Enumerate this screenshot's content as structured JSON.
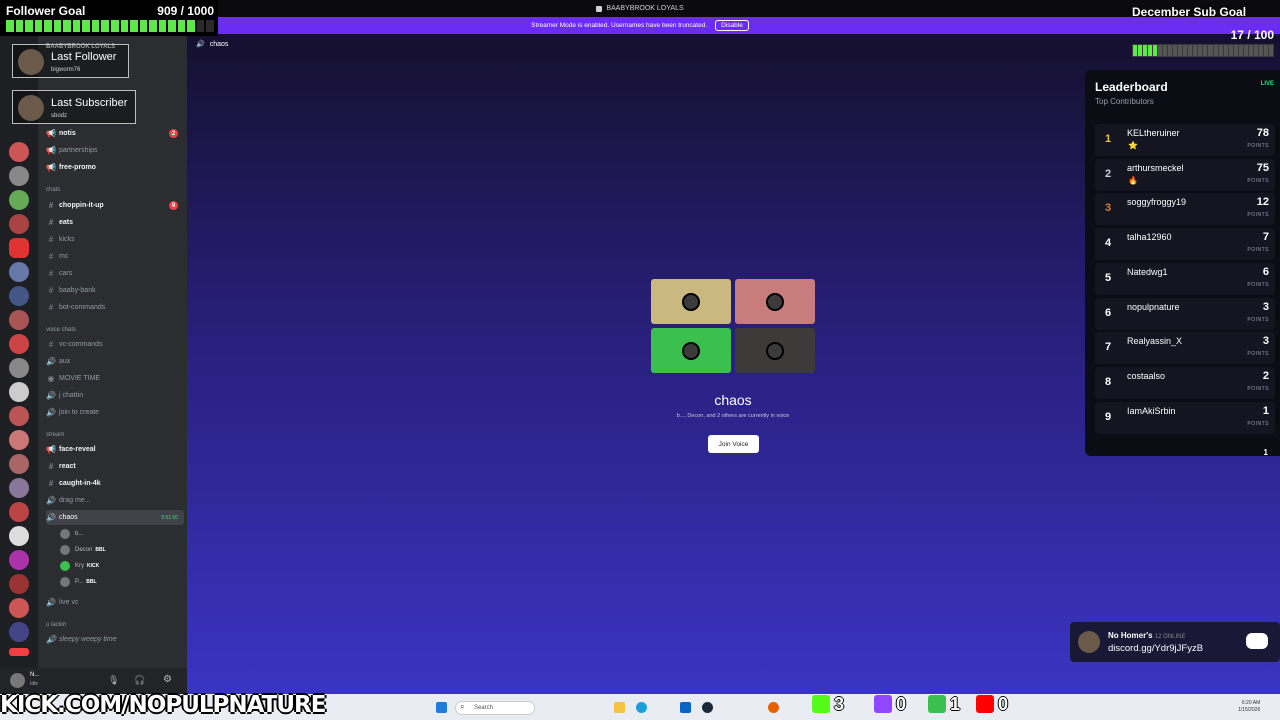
{
  "window": {
    "title": "BAABYBROOK LOYALS"
  },
  "notice": {
    "text": "Streamer Mode is enabled. Usernames have been truncated.",
    "disable_label": "Disable"
  },
  "follower_goal": {
    "title": "Follower Goal",
    "count": "909 / 1000",
    "progress": 0.909
  },
  "sub_goal": {
    "title": "December Sub Goal",
    "count": "17 / 100",
    "progress": 0.17
  },
  "overlays": {
    "last_follower": {
      "label": "Last Follower",
      "name": "bigworm76"
    },
    "last_subscriber": {
      "label": "Last Subscriber",
      "name": "sbodz"
    }
  },
  "server": {
    "name": "BAABYBROOK LOYALS"
  },
  "channels": {
    "c1": "notis",
    "c1_badge": "2",
    "c2": "partnerships",
    "c3": "free-promo",
    "cat_chats": "chats",
    "c4": "choppin-it-up",
    "c4_badge": "9",
    "c5": "eats",
    "c6": "kicks",
    "c7": "mc",
    "c8": "cars",
    "c9": "baaby-bank",
    "c10": "bot-commands",
    "cat_voice": "voice chats",
    "c11": "vc-commands",
    "c12": "aux",
    "c13": "MOVIE TIME",
    "c14": "j chattin",
    "c15": "join to create",
    "cat_stream": "stream",
    "c16": "face-reveal",
    "c17": "react",
    "c18": "caught-in-4k",
    "c19": "drag me...",
    "c20": "chaos",
    "c20_time": "5:51:50",
    "c21": "live vc",
    "cat_lackin": "u lackin",
    "c22": "sleepy weepy time"
  },
  "voice_users": [
    {
      "name": "b...",
      "tag": ""
    },
    {
      "name": "Decon",
      "tag": "BBL"
    },
    {
      "name": "Kry",
      "tag": "KICK"
    },
    {
      "name": "P...",
      "tag": "BBL"
    }
  ],
  "user": {
    "name": "N...",
    "status": "Idle"
  },
  "main": {
    "channel": "chaos",
    "voice_desc": "b..., Decon, and 2 others are currently in voice",
    "join_label": "Join Voice",
    "tile_colors": [
      "#c9b980",
      "#c87c7c",
      "#3bbf4e",
      "#3d3a3a"
    ]
  },
  "leaderboard": {
    "title": "Leaderboard",
    "subtitle": "Top Contributors",
    "live": "LIVE",
    "points_label": "POINTS",
    "rows": [
      {
        "rank": "1",
        "name": "KELtheruiner",
        "points": "78",
        "emoji": "⭐"
      },
      {
        "rank": "2",
        "name": "arthursmeckel",
        "points": "75",
        "emoji": "🔥"
      },
      {
        "rank": "3",
        "name": "soggyfroggy19",
        "points": "12",
        "emoji": ""
      },
      {
        "rank": "4",
        "name": "talha12960",
        "points": "7",
        "emoji": ""
      },
      {
        "rank": "5",
        "name": "Natedwg1",
        "points": "6",
        "emoji": ""
      },
      {
        "rank": "6",
        "name": "nopulpnature",
        "points": "3",
        "emoji": ""
      },
      {
        "rank": "7",
        "name": "Realyassin_X",
        "points": "3",
        "emoji": ""
      },
      {
        "rank": "8",
        "name": "costaalso",
        "points": "2",
        "emoji": ""
      },
      {
        "rank": "9",
        "name": "IamAkiSrbin",
        "points": "1",
        "emoji": ""
      }
    ],
    "partial_points": "1"
  },
  "invite": {
    "name": "No Homer's",
    "online": "12 ONLINE",
    "link": "discord.gg/Ydr9jJFyzB"
  },
  "banner": {
    "text": "KICK.COM/NOPULPNATURE"
  },
  "taskbar": {
    "search": "Search",
    "time": "6:20 AM",
    "date": "1/15/2026"
  },
  "stats": {
    "kick": "3",
    "twitch": "0",
    "green": "1",
    "youtube": "0"
  }
}
